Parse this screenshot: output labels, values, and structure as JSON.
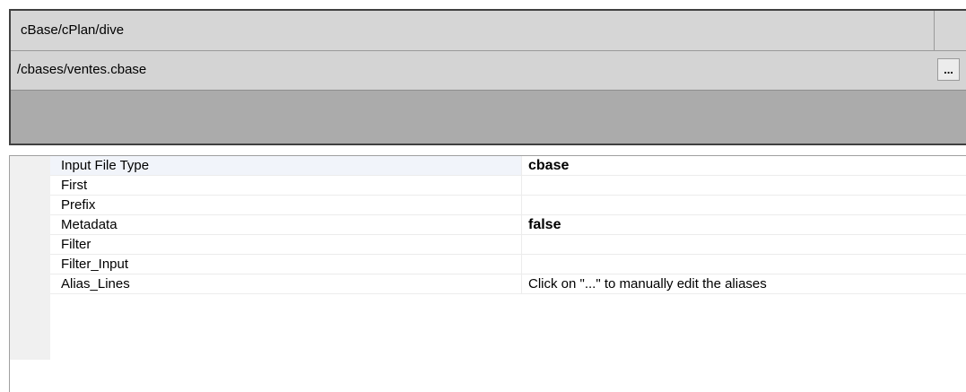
{
  "panel": {
    "header": "cBase/cPlan/dive",
    "path_value": "/cbases/ventes.cbase",
    "browse_label": "..."
  },
  "properties": [
    {
      "name": "Input File Type",
      "value": "cbase",
      "bold": true
    },
    {
      "name": "First",
      "value": ""
    },
    {
      "name": "Prefix",
      "value": ""
    },
    {
      "name": "Metadata",
      "value": "false",
      "bold": true
    },
    {
      "name": "Filter",
      "value": ""
    },
    {
      "name": "Filter_Input",
      "value": ""
    },
    {
      "name": "Alias_Lines",
      "value": "Click on \"...\" to manually edit the aliases"
    }
  ]
}
